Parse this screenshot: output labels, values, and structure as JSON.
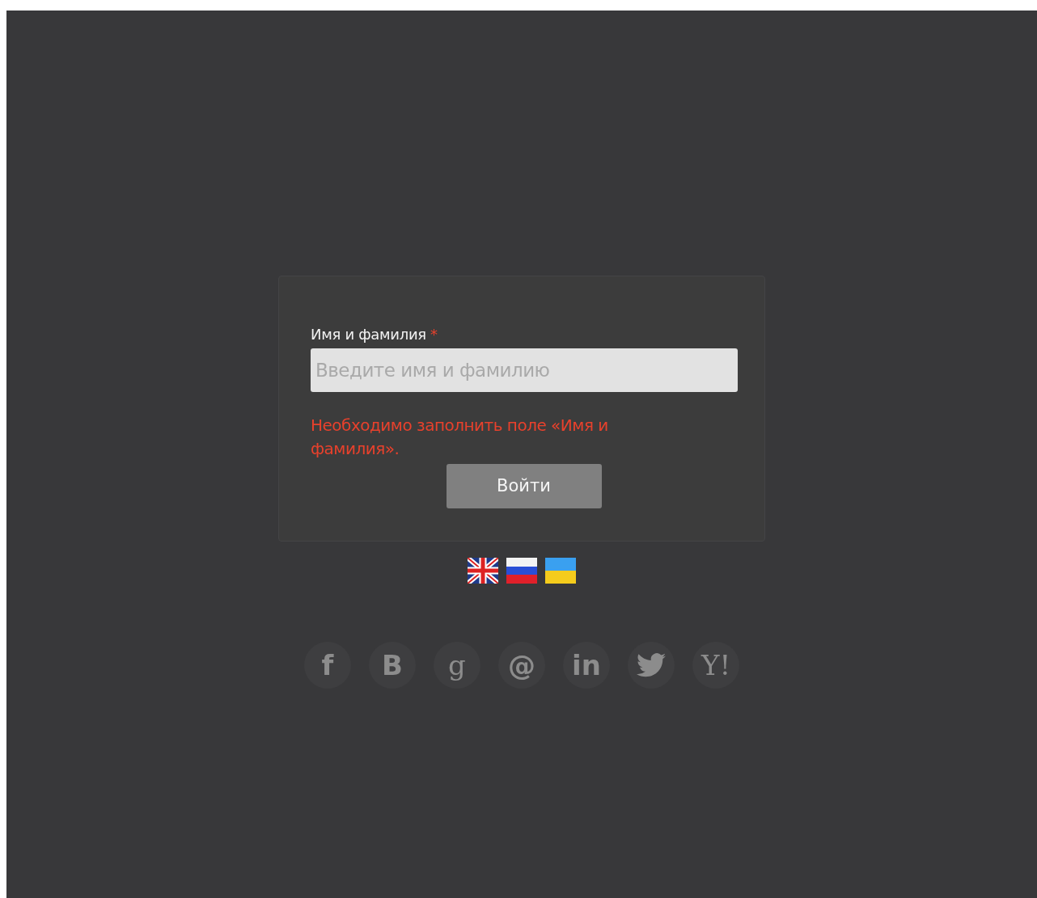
{
  "form": {
    "label": "Имя и фамилия",
    "required_mark": "*",
    "placeholder": "Введите имя и фамилию",
    "error": "Необходимо заполнить поле «Имя и фамилия».",
    "submit": "Войти"
  },
  "languages": [
    {
      "kind": "en"
    },
    {
      "kind": "ru"
    },
    {
      "kind": "ua"
    }
  ],
  "social": [
    {
      "kind": "glyph",
      "glyph": "f",
      "serif": false
    },
    {
      "kind": "glyph",
      "glyph": "B",
      "serif": false
    },
    {
      "kind": "glyph",
      "glyph": "g",
      "serif": true
    },
    {
      "kind": "glyph",
      "glyph": "@",
      "serif": false
    },
    {
      "kind": "glyph",
      "glyph": "in",
      "serif": false
    },
    {
      "kind": "bird"
    },
    {
      "kind": "glyph",
      "glyph": "Y!",
      "serif": true
    }
  ]
}
